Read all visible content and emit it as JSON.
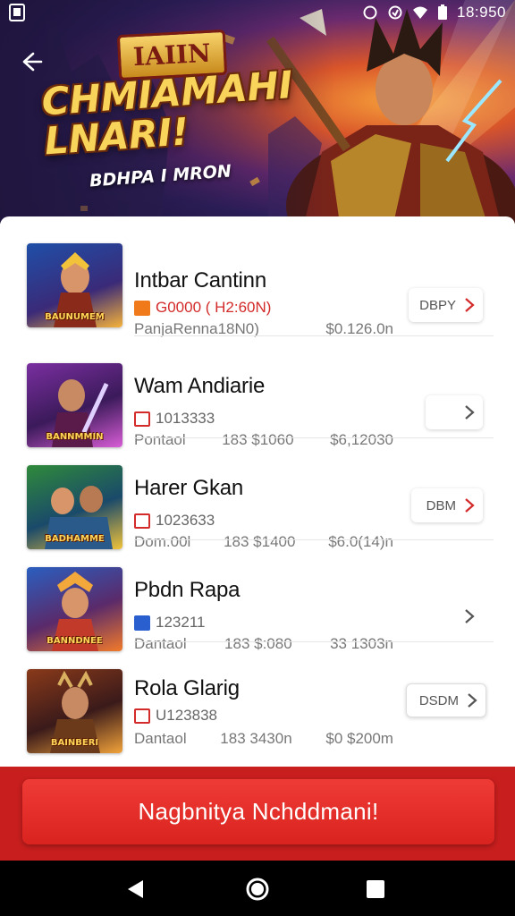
{
  "statusbar": {
    "time": "18:950"
  },
  "hero": {
    "badge": "IAIIN",
    "title": "CHMIAMAHI LNARI!",
    "subtitle": "BDHPA I MRON"
  },
  "games": [
    {
      "title": "Intbar Cantinn",
      "tag": "G0000 ( H2:60N)",
      "tag_style": "red",
      "meta_left": "PanjaRenna18N0)",
      "meta_mid": "",
      "meta_right": "$0.126.0n",
      "action_label": "DBPY",
      "thumb_label": "BAUNUMEM",
      "thumb_colors": [
        "#1f4fa8",
        "#f6b33a"
      ]
    },
    {
      "title": "Wam Andiarie",
      "tag": "1013333",
      "tag_style": "gray",
      "meta_left": "Pontaol",
      "meta_mid": "183 $1060",
      "meta_right": "$6,12030",
      "action_label": "",
      "thumb_label": "BANNMMIN",
      "thumb_colors": [
        "#7a2fa0",
        "#d85dd6"
      ]
    },
    {
      "title": "Harer Gkan",
      "tag": "1023633",
      "tag_style": "gray",
      "meta_left": "Dom.00l",
      "meta_mid": "183 $1400",
      "meta_right": "$6.0(14)n",
      "action_label": "DBM",
      "thumb_label": "BADHAMME",
      "thumb_colors": [
        "#2f8a3a",
        "#f1c33a"
      ]
    },
    {
      "title": "Pbdn Rapa",
      "tag": "123211",
      "tag_style": "gray",
      "meta_left": "Dantaol",
      "meta_mid": "183 $:080",
      "meta_right": "33 1303n",
      "action_label": "",
      "thumb_label": "BANNDNEE",
      "thumb_colors": [
        "#2a5fc0",
        "#f27a2a"
      ]
    },
    {
      "title": "Rola Glarig",
      "tag": "U123838",
      "tag_style": "gray",
      "meta_left": "Dantaol",
      "meta_mid": "183 3430n",
      "meta_right": "$0 $200m",
      "action_label": "DSDM",
      "thumb_label": "BAINBERI",
      "thumb_colors": [
        "#8a3a1a",
        "#f2a33a"
      ]
    }
  ],
  "cta": {
    "label": "Nagbnitya Nchddmani!"
  },
  "colors": {
    "accent": "#d9231f",
    "cta_bar": "#c81e1e",
    "tag_red": "#d32a2a"
  },
  "icons": {
    "back": "arrow-left-icon",
    "chevron": "chevron-right-icon",
    "nav_back": "triangle-back-icon",
    "nav_home": "circle-home-icon",
    "nav_recent": "square-recent-icon"
  }
}
